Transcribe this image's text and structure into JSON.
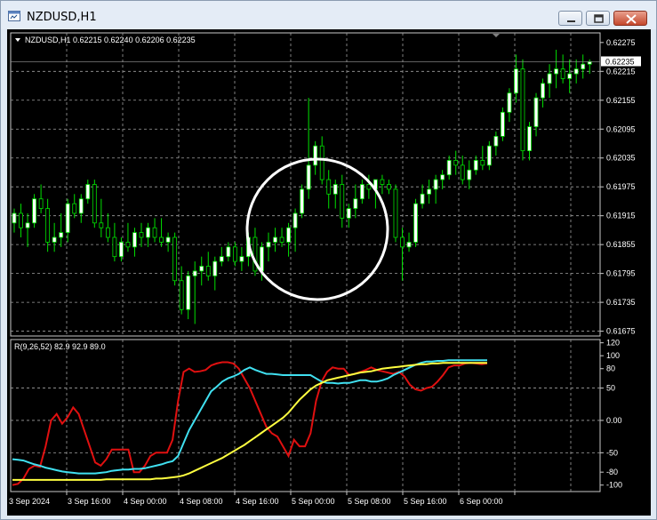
{
  "window": {
    "title": "NZDUSD,H1"
  },
  "chart": {
    "header": "NZDUSD,H1  0.62215 0.62240 0.62206 0.62235",
    "price_labels": [
      "0.62275",
      "0.62215",
      "0.62155",
      "0.62095",
      "0.62035",
      "0.61975",
      "0.61915",
      "0.61855",
      "0.61795",
      "0.61735",
      "0.61675"
    ],
    "current_price": "0.62235",
    "indicator_header": "R(9,26,52) 82.9 92.9 89.0",
    "indicator_labels": [
      "120",
      "100",
      "80",
      "50",
      "0.00",
      "-50",
      "-80",
      "-100"
    ],
    "time_labels": [
      "3 Sep 2024",
      "3 Sep 16:00",
      "4 Sep 00:00",
      "4 Sep 08:00",
      "4 Sep 16:00",
      "5 Sep 00:00",
      "5 Sep 08:00",
      "5 Sep 16:00",
      "6 Sep 00:00"
    ],
    "colors": {
      "background": "#000000",
      "candle_bull": "#ffffff",
      "candle_wick": "#00e000",
      "grid": "#a0a0a0",
      "series_red": "#e01010",
      "series_cyan": "#40e0f0",
      "series_yellow": "#ffff40",
      "circle": "#ffffff"
    }
  },
  "chart_data": [
    {
      "type": "candlestick",
      "title": "NZDUSD,H1",
      "ylim": [
        0.61665,
        0.62295
      ],
      "x_ticks": [
        "3 Sep 2024",
        "3 Sep 16:00",
        "4 Sep 00:00",
        "4 Sep 08:00",
        "4 Sep 16:00",
        "5 Sep 00:00",
        "5 Sep 08:00",
        "5 Sep 16:00",
        "6 Sep 00:00"
      ],
      "candles": [
        [
          0.619,
          0.6193,
          0.6188,
          0.6192
        ],
        [
          0.6192,
          0.6194,
          0.6187,
          0.6189
        ],
        [
          0.6189,
          0.6192,
          0.6185,
          0.619
        ],
        [
          0.619,
          0.6196,
          0.6189,
          0.6195
        ],
        [
          0.6195,
          0.6198,
          0.6192,
          0.6193
        ],
        [
          0.6193,
          0.6195,
          0.6184,
          0.6186
        ],
        [
          0.6186,
          0.619,
          0.6184,
          0.6187
        ],
        [
          0.6187,
          0.6192,
          0.6185,
          0.6188
        ],
        [
          0.6188,
          0.6195,
          0.6186,
          0.6194
        ],
        [
          0.6194,
          0.6196,
          0.6191,
          0.6192
        ],
        [
          0.6192,
          0.6196,
          0.619,
          0.6195
        ],
        [
          0.6195,
          0.6199,
          0.6194,
          0.6198
        ],
        [
          0.6198,
          0.6199,
          0.6189,
          0.619
        ],
        [
          0.619,
          0.6195,
          0.6187,
          0.6189
        ],
        [
          0.6189,
          0.6192,
          0.6186,
          0.6187
        ],
        [
          0.6187,
          0.619,
          0.6182,
          0.6183
        ],
        [
          0.6183,
          0.6187,
          0.6182,
          0.6186
        ],
        [
          0.6186,
          0.619,
          0.6184,
          0.6185
        ],
        [
          0.6185,
          0.6189,
          0.6183,
          0.6188
        ],
        [
          0.6188,
          0.619,
          0.6185,
          0.6187
        ],
        [
          0.6187,
          0.619,
          0.6185,
          0.6189
        ],
        [
          0.6189,
          0.6191,
          0.6186,
          0.6187
        ],
        [
          0.6187,
          0.6191,
          0.6185,
          0.6186
        ],
        [
          0.6186,
          0.6188,
          0.6184,
          0.6187
        ],
        [
          0.6187,
          0.6188,
          0.6177,
          0.6178
        ],
        [
          0.6178,
          0.6181,
          0.6171,
          0.6172
        ],
        [
          0.6172,
          0.618,
          0.617,
          0.6179
        ],
        [
          0.6179,
          0.6182,
          0.6169,
          0.618
        ],
        [
          0.618,
          0.6183,
          0.6177,
          0.6181
        ],
        [
          0.6181,
          0.6184,
          0.6178,
          0.6179
        ],
        [
          0.6179,
          0.6183,
          0.6176,
          0.6182
        ],
        [
          0.6182,
          0.6185,
          0.6181,
          0.6183
        ],
        [
          0.6183,
          0.6186,
          0.6182,
          0.6185
        ],
        [
          0.6185,
          0.6186,
          0.6181,
          0.6182
        ],
        [
          0.6182,
          0.6185,
          0.618,
          0.6183
        ],
        [
          0.6183,
          0.6188,
          0.6181,
          0.6187
        ],
        [
          0.6187,
          0.6189,
          0.6179,
          0.618
        ],
        [
          0.618,
          0.6186,
          0.6178,
          0.6185
        ],
        [
          0.6185,
          0.6188,
          0.6182,
          0.6186
        ],
        [
          0.6186,
          0.6189,
          0.6184,
          0.6187
        ],
        [
          0.6187,
          0.6189,
          0.6185,
          0.6186
        ],
        [
          0.6186,
          0.619,
          0.6183,
          0.6189
        ],
        [
          0.6189,
          0.6193,
          0.6184,
          0.6192
        ],
        [
          0.6192,
          0.6198,
          0.6191,
          0.6197
        ],
        [
          0.6197,
          0.6216,
          0.6195,
          0.6202
        ],
        [
          0.6202,
          0.6207,
          0.62,
          0.6206
        ],
        [
          0.6206,
          0.6208,
          0.6198,
          0.6199
        ],
        [
          0.6199,
          0.6201,
          0.6193,
          0.6196
        ],
        [
          0.6196,
          0.6199,
          0.6193,
          0.6198
        ],
        [
          0.6198,
          0.62,
          0.6189,
          0.6191
        ],
        [
          0.6191,
          0.6194,
          0.6189,
          0.6193
        ],
        [
          0.6193,
          0.6198,
          0.6191,
          0.6195
        ],
        [
          0.6195,
          0.6199,
          0.6194,
          0.6198
        ],
        [
          0.6198,
          0.62,
          0.6195,
          0.6197
        ],
        [
          0.6197,
          0.6199,
          0.6193,
          0.6199
        ],
        [
          0.6199,
          0.62,
          0.6196,
          0.6198
        ],
        [
          0.6198,
          0.6199,
          0.6196,
          0.6197
        ],
        [
          0.6197,
          0.6198,
          0.6186,
          0.6187
        ],
        [
          0.6187,
          0.6189,
          0.6178,
          0.6185
        ],
        [
          0.6185,
          0.6188,
          0.6184,
          0.6186
        ],
        [
          0.6186,
          0.6195,
          0.6185,
          0.6194
        ],
        [
          0.6194,
          0.6198,
          0.6193,
          0.6196
        ],
        [
          0.6196,
          0.6199,
          0.6194,
          0.6197
        ],
        [
          0.6197,
          0.62,
          0.6194,
          0.6199
        ],
        [
          0.6199,
          0.6201,
          0.6197,
          0.62
        ],
        [
          0.62,
          0.6204,
          0.6199,
          0.6203
        ],
        [
          0.6203,
          0.6205,
          0.62,
          0.6202
        ],
        [
          0.6202,
          0.6204,
          0.6198,
          0.6199
        ],
        [
          0.6199,
          0.6203,
          0.6197,
          0.6201
        ],
        [
          0.6201,
          0.6204,
          0.62,
          0.6203
        ],
        [
          0.6203,
          0.6206,
          0.6201,
          0.6202
        ],
        [
          0.6202,
          0.6207,
          0.6201,
          0.6206
        ],
        [
          0.6206,
          0.6209,
          0.6204,
          0.6208
        ],
        [
          0.6208,
          0.6214,
          0.6207,
          0.6213
        ],
        [
          0.6213,
          0.6218,
          0.6211,
          0.6217
        ],
        [
          0.6217,
          0.6225,
          0.6215,
          0.6222
        ],
        [
          0.6222,
          0.6224,
          0.6203,
          0.6205
        ],
        [
          0.6205,
          0.6211,
          0.6203,
          0.621
        ],
        [
          0.621,
          0.6217,
          0.6208,
          0.6216
        ],
        [
          0.6216,
          0.622,
          0.6214,
          0.6219
        ],
        [
          0.6219,
          0.6223,
          0.6216,
          0.6221
        ],
        [
          0.6221,
          0.6226,
          0.6218,
          0.6222
        ],
        [
          0.6222,
          0.6225,
          0.6219,
          0.622
        ],
        [
          0.622,
          0.6224,
          0.6217,
          0.6221
        ],
        [
          0.6221,
          0.6224,
          0.6219,
          0.6222
        ],
        [
          0.6222,
          0.6225,
          0.622,
          0.6223
        ],
        [
          0.6223,
          0.6224,
          0.6221,
          0.62235
        ]
      ]
    },
    {
      "type": "line",
      "title": "R(9,26,52) 82.9 92.9 89.0",
      "ylim": [
        -110,
        125
      ],
      "x_ticks": [
        "3 Sep 2024",
        "3 Sep 16:00",
        "4 Sep 00:00",
        "4 Sep 08:00",
        "4 Sep 16:00",
        "5 Sep 00:00",
        "5 Sep 08:00",
        "5 Sep 16:00",
        "6 Sep 00:00"
      ],
      "x": [
        0,
        1,
        2,
        3,
        4,
        5,
        6,
        7,
        8,
        9,
        10,
        11,
        12,
        13,
        14,
        15,
        16,
        17,
        18,
        19,
        20,
        21,
        22,
        23,
        24,
        25,
        26,
        27,
        28,
        29,
        30,
        31,
        32,
        33,
        34,
        35,
        36,
        37,
        38,
        39,
        40,
        41,
        42,
        43,
        44,
        45,
        46,
        47,
        48,
        49,
        50,
        51,
        52,
        53,
        54,
        55,
        56,
        57,
        58,
        59,
        60,
        61,
        62,
        63,
        64,
        65,
        66,
        67,
        68,
        69,
        70,
        71,
        72,
        73,
        74,
        75,
        76,
        77,
        78,
        79,
        80,
        81,
        82,
        83,
        84,
        85,
        86
      ],
      "series": [
        {
          "values": [
            -100,
            -98,
            -90,
            -75,
            -70,
            -72,
            -40,
            0,
            10,
            -5,
            5,
            20,
            10,
            -15,
            -40,
            -65,
            -70,
            -60,
            -45,
            -45,
            -45,
            -45,
            -80,
            -80,
            -70,
            -55,
            -50,
            -50,
            -50,
            -30,
            30,
            75,
            80,
            75,
            76,
            78,
            85,
            88,
            90,
            90,
            88,
            80,
            65,
            50,
            30,
            10,
            -10,
            -20,
            -25,
            -40,
            -55,
            -30,
            -40,
            -40,
            -20,
            30,
            60,
            75,
            82,
            80,
            80,
            70,
            72,
            75,
            78,
            82,
            78,
            76,
            74,
            72,
            75,
            68,
            55,
            48,
            46,
            50,
            52,
            60,
            70,
            82,
            85,
            85,
            88,
            89,
            88,
            87,
            88
          ]
        },
        {
          "values": [
            -60,
            -61,
            -62,
            -65,
            -68,
            -70,
            -73,
            -75,
            -77,
            -79,
            -80,
            -81,
            -82,
            -82,
            -82,
            -82,
            -81,
            -80,
            -78,
            -77,
            -76,
            -76,
            -75,
            -75,
            -74,
            -72,
            -70,
            -68,
            -65,
            -63,
            -55,
            -35,
            -15,
            0,
            15,
            30,
            45,
            52,
            60,
            65,
            68,
            72,
            78,
            82,
            78,
            75,
            72,
            72,
            71,
            70,
            70,
            70,
            70,
            70,
            70,
            65,
            60,
            58,
            58,
            57,
            58,
            58,
            60,
            62,
            62,
            60,
            60,
            62,
            65,
            70,
            74,
            78,
            82,
            86,
            89,
            91,
            91,
            92,
            92,
            93,
            93,
            93,
            93,
            93,
            93,
            93,
            93
          ]
        },
        {
          "values": [
            -92,
            -92,
            -92,
            -92,
            -92,
            -92,
            -92,
            -92,
            -92,
            -92,
            -92,
            -92,
            -92,
            -92,
            -92,
            -92,
            -92,
            -91,
            -91,
            -91,
            -91,
            -91,
            -91,
            -91,
            -91,
            -91,
            -90,
            -90,
            -89,
            -88,
            -87,
            -85,
            -82,
            -78,
            -74,
            -70,
            -66,
            -62,
            -58,
            -53,
            -48,
            -43,
            -38,
            -32,
            -26,
            -20,
            -14,
            -8,
            -2,
            4,
            12,
            22,
            32,
            40,
            48,
            54,
            58,
            62,
            64,
            66,
            68,
            70,
            72,
            74,
            75,
            76,
            78,
            80,
            81,
            82,
            83,
            84,
            85,
            86,
            87,
            87,
            88,
            88,
            89,
            89,
            89,
            89,
            89,
            89,
            89,
            89,
            89
          ]
        }
      ]
    }
  ]
}
